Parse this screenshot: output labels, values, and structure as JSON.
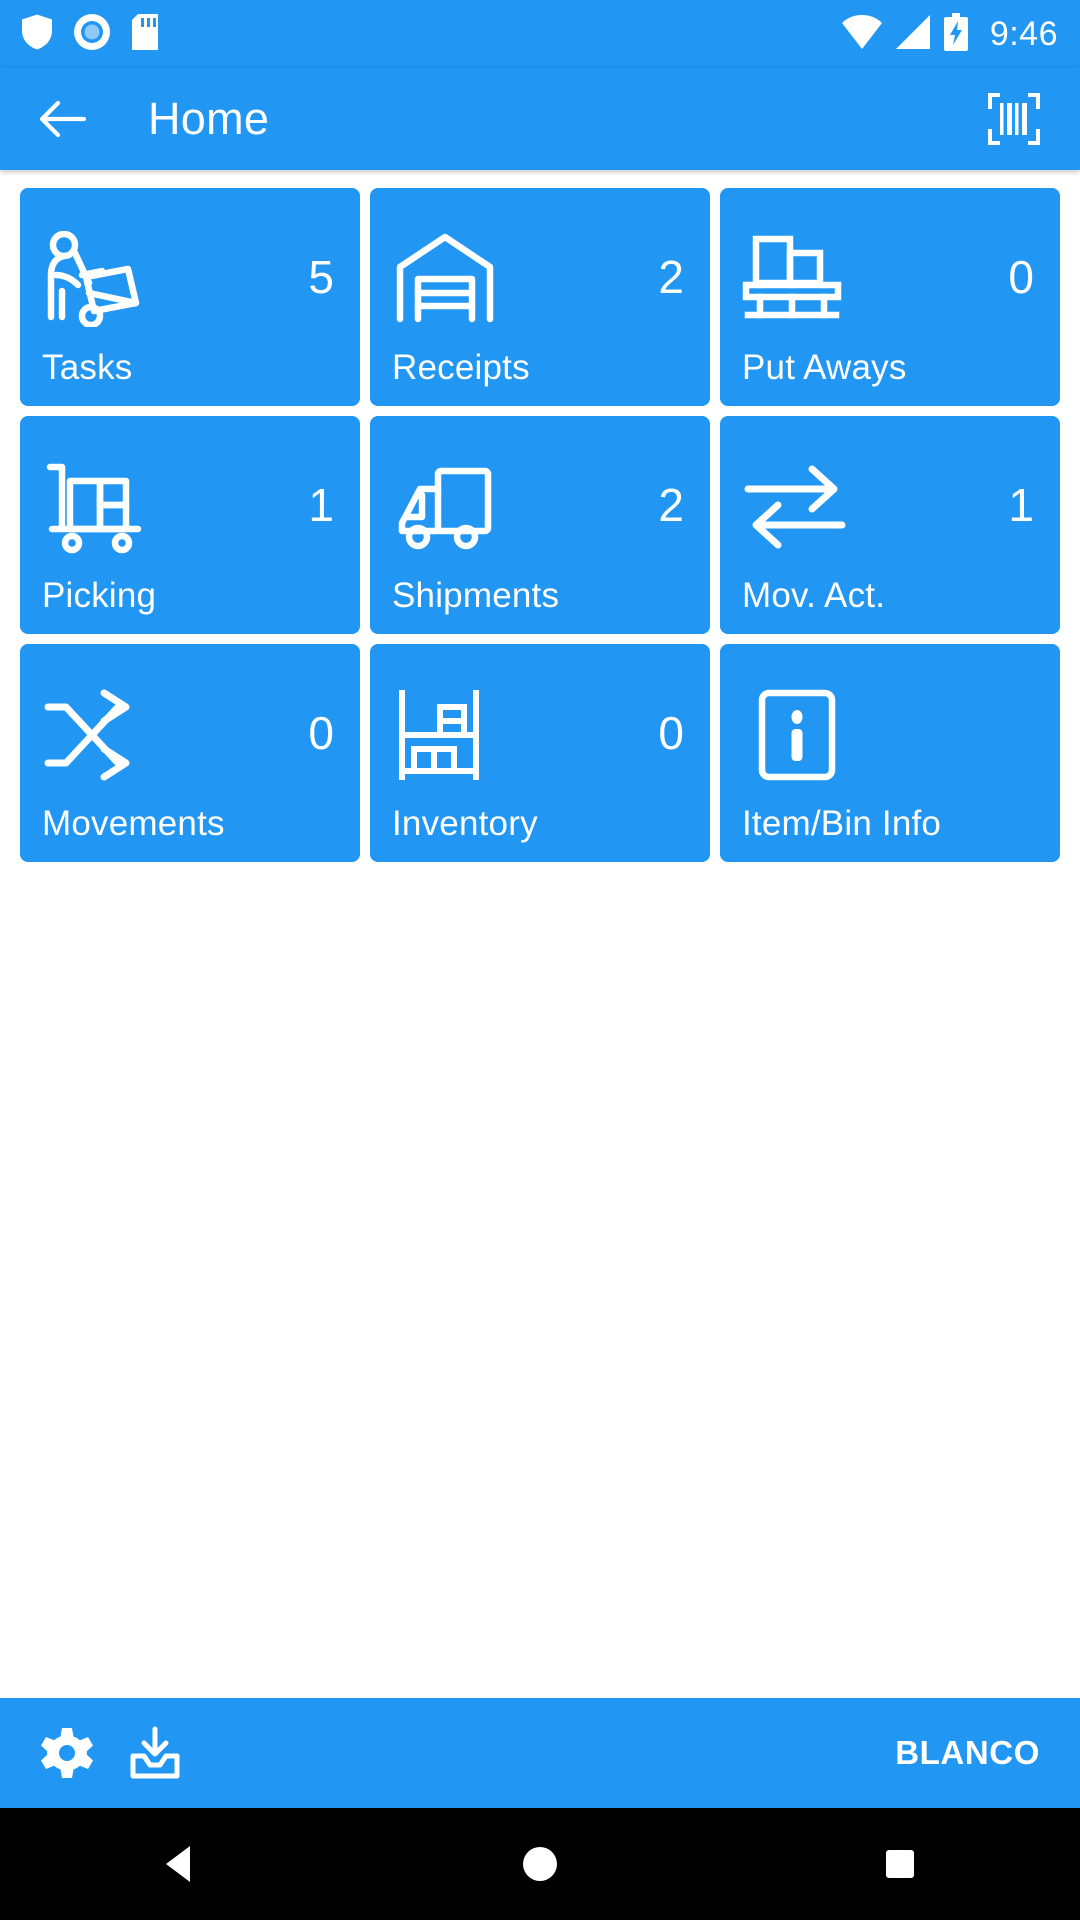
{
  "status_bar": {
    "icons": [
      "shield-icon",
      "record-circle-icon",
      "sd-card-icon"
    ],
    "right_icons": [
      "wifi-icon",
      "cell-signal-icon",
      "battery-charging-icon"
    ],
    "time": "9:46"
  },
  "app_bar": {
    "back_icon": "back-arrow-icon",
    "title": "Home",
    "action_icon": "barcode-scan-icon"
  },
  "colors": {
    "accent": "#2196f3",
    "tile": "#2196f3",
    "background": "#ffffff",
    "on_accent": "#ffffff",
    "nav_bar": "#000000"
  },
  "grid": {
    "tiles": [
      {
        "label": "Tasks",
        "count": "5",
        "icon": "hand-truck-worker-icon"
      },
      {
        "label": "Receipts",
        "count": "2",
        "icon": "warehouse-icon"
      },
      {
        "label": "Put Aways",
        "count": "0",
        "icon": "boxes-on-shelf-icon"
      },
      {
        "label": "Picking",
        "count": "1",
        "icon": "pallet-cart-icon"
      },
      {
        "label": "Shipments",
        "count": "2",
        "icon": "delivery-truck-icon"
      },
      {
        "label": "Mov. Act.",
        "count": "1",
        "icon": "transfer-arrows-icon"
      },
      {
        "label": "Movements",
        "count": "0",
        "icon": "shuffle-arrows-icon"
      },
      {
        "label": "Inventory",
        "count": "0",
        "icon": "rack-shelving-icon"
      },
      {
        "label": "Item/Bin Info",
        "count": "",
        "icon": "info-square-icon"
      }
    ]
  },
  "bottom_bar": {
    "settings_icon": "gear-icon",
    "download_icon": "inbox-download-icon",
    "company": "BLANCO"
  },
  "nav_bar": {
    "back": "triangle-back-icon",
    "home": "circle-home-icon",
    "recents": "square-recents-icon"
  }
}
